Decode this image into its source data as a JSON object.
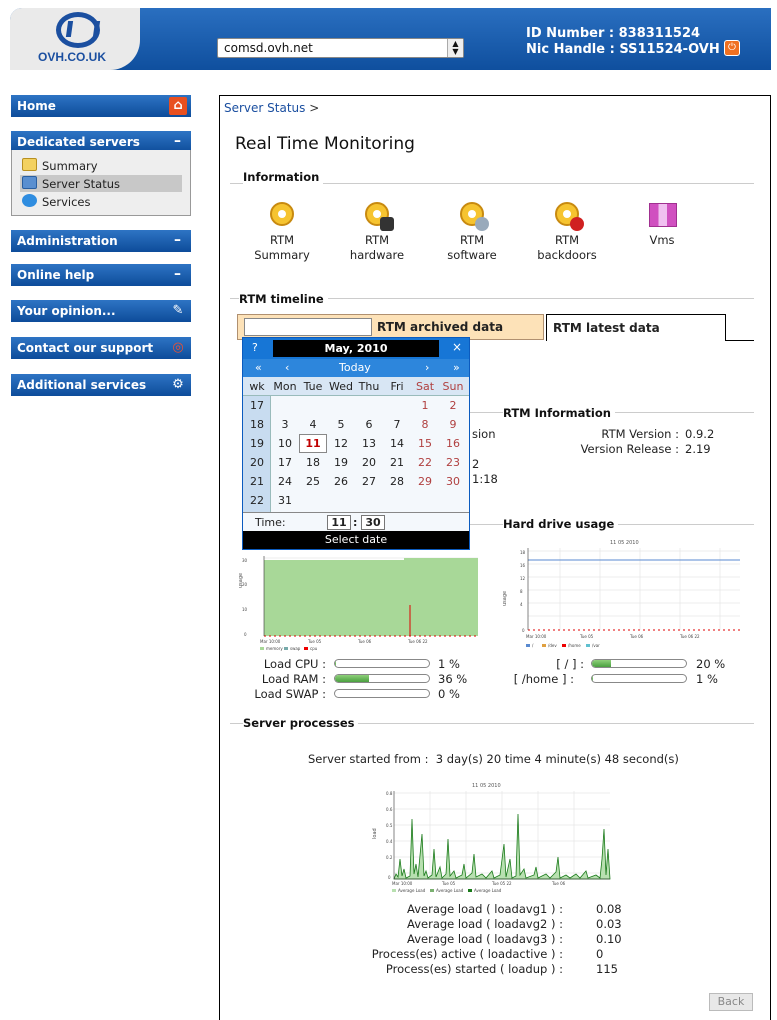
{
  "header": {
    "logo_text": "OVH.CO.UK",
    "domain_selected": "comsd.ovh.net",
    "id_label": "ID Number :",
    "id_value": "838311524",
    "nic_label": "Nic Handle :",
    "nic_value": "SS11524-OVH"
  },
  "nav": {
    "home": "Home",
    "dedicated": "Dedicated servers",
    "dedicated_items": [
      "Summary",
      "Server Status",
      "Services"
    ],
    "administration": "Administration",
    "online_help": "Online help",
    "opinion": "Your opinion...",
    "contact": "Contact our support",
    "additional": "Additional services",
    "collapse_symbol": "–"
  },
  "main": {
    "breadcrumb": "Server Status",
    "breadcrumb_sep": ">",
    "title": "Real Time Monitoring",
    "information_title": "Information",
    "rtm_icons": [
      {
        "line1": "RTM",
        "line2": "Summary"
      },
      {
        "line1": "RTM",
        "line2": "hardware"
      },
      {
        "line1": "RTM",
        "line2": "software"
      },
      {
        "line1": "RTM",
        "line2": "backdoors"
      },
      {
        "line1": "Vms",
        "line2": ""
      }
    ],
    "timeline_title": "RTM timeline",
    "tab_archived": "RTM archived data",
    "tab_latest": "RTM latest data",
    "rtm_info_title": "RTM Information",
    "rtm_version_label": "RTM Version :",
    "rtm_version_value": "0.9.2",
    "version_release_label": "Version Release :",
    "version_release_value": "2.19",
    "partial_text_1": "sion",
    "partial_text_2": "2",
    "partial_text_3": "1:18",
    "hdd_title": "Hard drive usage",
    "load": [
      {
        "label": "Load CPU :",
        "value": "1 %",
        "pct": 1
      },
      {
        "label": "Load RAM :",
        "value": "36 %",
        "pct": 36
      },
      {
        "label": "Load SWAP :",
        "value": "0 %",
        "pct": 0
      }
    ],
    "disks": [
      {
        "label": "[ / ] :",
        "value": "20 %",
        "pct": 20
      },
      {
        "label": "[ /home ] :",
        "value": "1 %",
        "pct": 1
      }
    ],
    "processes_title": "Server processes",
    "started_label": "Server started from :",
    "started_value": "3 day(s) 20 time 4 minute(s) 48 second(s)",
    "averages": [
      {
        "label": "Average load ( loadavg1 ) :",
        "value": "0.08"
      },
      {
        "label": "Average load ( loadavg2 ) :",
        "value": "0.03"
      },
      {
        "label": "Average load ( loadavg3 ) :",
        "value": "0.10"
      },
      {
        "label": "Process(es) active ( loadactive ) :",
        "value": "0"
      },
      {
        "label": "Process(es) started ( loadup ) :",
        "value": "115"
      }
    ],
    "back": "Back"
  },
  "calendar": {
    "help": "?",
    "month": "May, 2010",
    "close": "×",
    "nav_prev_year": "«",
    "nav_prev_month": "‹",
    "nav_today": "Today",
    "nav_next_month": "›",
    "nav_next_year": "»",
    "dow": [
      "wk",
      "Mon",
      "Tue",
      "Wed",
      "Thu",
      "Fri",
      "Sat",
      "Sun"
    ],
    "weeks": [
      {
        "wk": "17",
        "days": [
          "",
          "",
          "",
          "",
          "",
          "1",
          "2"
        ]
      },
      {
        "wk": "18",
        "days": [
          "3",
          "4",
          "5",
          "6",
          "7",
          "8",
          "9"
        ]
      },
      {
        "wk": "19",
        "days": [
          "10",
          "11",
          "12",
          "13",
          "14",
          "15",
          "16"
        ]
      },
      {
        "wk": "20",
        "days": [
          "17",
          "18",
          "19",
          "20",
          "21",
          "22",
          "23"
        ]
      },
      {
        "wk": "21",
        "days": [
          "24",
          "25",
          "26",
          "27",
          "28",
          "29",
          "30"
        ]
      },
      {
        "wk": "22",
        "days": [
          "31",
          "",
          "",
          "",
          "",
          "",
          ""
        ]
      }
    ],
    "today": "11",
    "time_label": "Time:",
    "hour": "11",
    "minute": "30",
    "time_sep": ":",
    "select_date": "Select date"
  },
  "charts": {
    "load_title": "",
    "hdd_title": "11 05 2010",
    "proc_title": "11 05 2010",
    "hdd_legend": [
      "/",
      "/dev",
      "/home",
      "/var"
    ],
    "proc_legend": [
      "Average Load",
      "Average Load",
      "Average Load"
    ],
    "load_legend": [
      "memory",
      "swap",
      "cpu"
    ]
  },
  "colors": {
    "nav_blue": "#0d4c9a",
    "archived_tab": "#fde2b8",
    "calendar_blue": "#1776d6",
    "bar_green": "#4aa040"
  }
}
